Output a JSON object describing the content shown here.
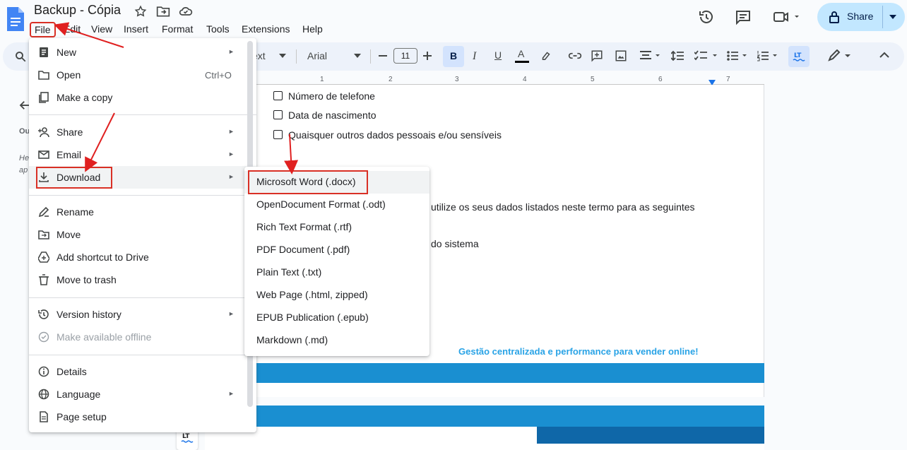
{
  "app": {
    "title": "Backup - Cópia",
    "menu": [
      "File",
      "Edit",
      "View",
      "Insert",
      "Format",
      "Tools",
      "Extensions",
      "Help"
    ],
    "share_label": "Share"
  },
  "toolbar": {
    "style_partial": "ext",
    "font": "Arial",
    "font_size": "11",
    "bold": "B",
    "italic": "I",
    "underline": "U",
    "text_color": "A"
  },
  "ruler": [
    "1",
    "1",
    "2",
    "3",
    "4",
    "5",
    "6",
    "7"
  ],
  "left_panel": {
    "outline_partial": "Ou",
    "hint_line1": "He",
    "hint_line2": "ap"
  },
  "document": {
    "lines": [
      "Número de telefone",
      "Data de nascimento",
      "Quaisquer outros dados pessoais e/ou sensíveis"
    ],
    "partial_text_1": "utilize os seus dados listados neste termo para as seguintes",
    "partial_text_2": "do sistema",
    "footer_text": "Gestão centralizada e performance para vender online!"
  },
  "file_menu": {
    "items": [
      {
        "label": "New",
        "icon": "new-doc-icon",
        "arrow": true
      },
      {
        "label": "Open",
        "icon": "folder-icon",
        "shortcut": "Ctrl+O"
      },
      {
        "label": "Make a copy",
        "icon": "copy-icon"
      },
      {
        "label": "Share",
        "icon": "person-add-icon",
        "arrow": true
      },
      {
        "label": "Email",
        "icon": "mail-icon",
        "arrow": true
      },
      {
        "label": "Download",
        "icon": "download-icon",
        "arrow": true,
        "highlighted": true
      },
      {
        "label": "Rename",
        "icon": "rename-icon"
      },
      {
        "label": "Move",
        "icon": "move-folder-icon"
      },
      {
        "label": "Add shortcut to Drive",
        "icon": "drive-shortcut-icon"
      },
      {
        "label": "Move to trash",
        "icon": "trash-icon"
      },
      {
        "label": "Version history",
        "icon": "history-icon",
        "arrow": true
      },
      {
        "label": "Make available offline",
        "icon": "offline-icon",
        "disabled": true
      },
      {
        "label": "Details",
        "icon": "info-icon"
      },
      {
        "label": "Language",
        "icon": "globe-icon",
        "arrow": true
      },
      {
        "label": "Page setup",
        "icon": "page-icon"
      }
    ],
    "arrow_glyph": "►"
  },
  "download_submenu": {
    "items": [
      "Microsoft Word (.docx)",
      "OpenDocument Format (.odt)",
      "Rich Text Format (.rtf)",
      "PDF Document (.pdf)",
      "Plain Text (.txt)",
      "Web Page (.html, zipped)",
      "EPUB Publication (.epub)",
      "Markdown (.md)"
    ]
  },
  "colors": {
    "highlight_box": "#d93025",
    "share_bg": "#c2e7ff",
    "brand_blue": "#1a8fd1"
  }
}
